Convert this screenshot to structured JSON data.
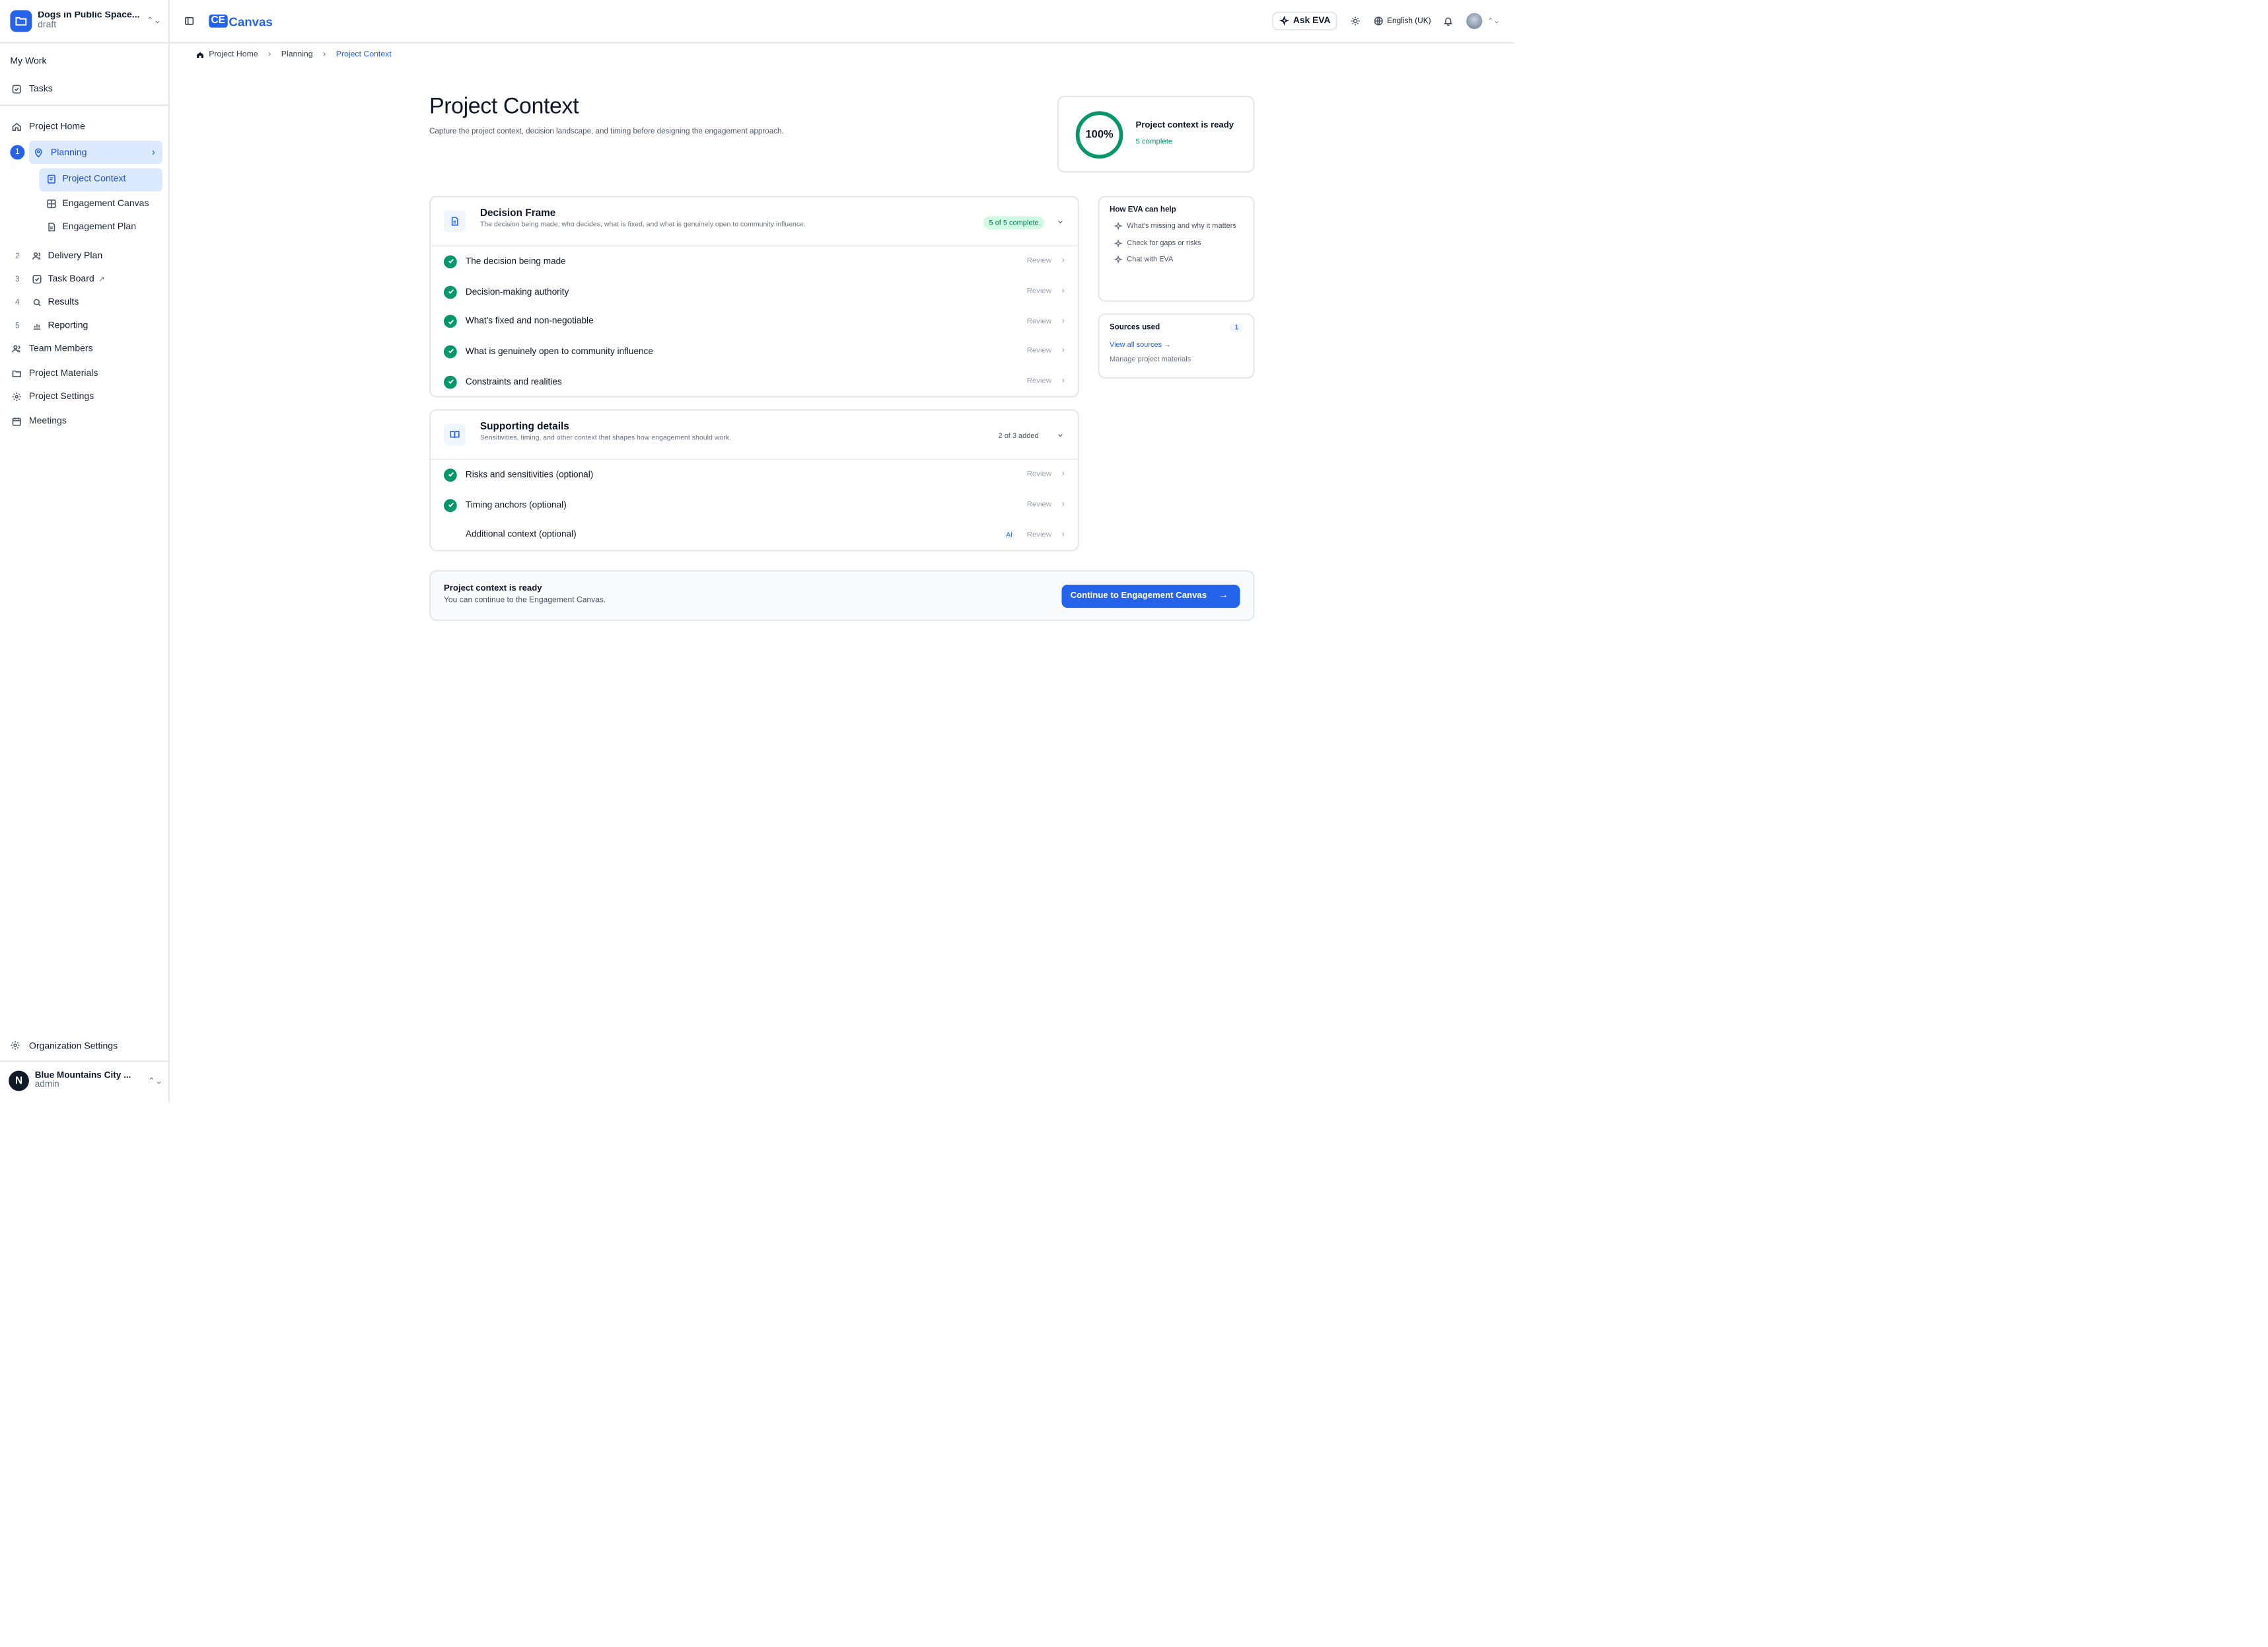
{
  "project": {
    "name": "Dogs in Public Space...",
    "status": "draft"
  },
  "nav": {
    "my_work": "My Work",
    "tasks": "Tasks",
    "project_home": "Project Home",
    "planning": {
      "num": "1",
      "label": "Planning"
    },
    "planning_sub": [
      "Project Context",
      "Engagement Canvas",
      "Engagement Plan"
    ],
    "steps": [
      {
        "num": "2",
        "label": "Delivery Plan"
      },
      {
        "num": "3",
        "label": "Task Board"
      },
      {
        "num": "4",
        "label": "Results"
      },
      {
        "num": "5",
        "label": "Reporting"
      }
    ],
    "team_members": "Team Members",
    "project_materials": "Project Materials",
    "project_settings": "Project Settings",
    "meetings": "Meetings",
    "org_settings": "Organization Settings"
  },
  "user": {
    "initial": "N",
    "org": "Blue Mountains City ...",
    "role": "admin"
  },
  "header": {
    "logo_badge": "CE",
    "logo_text": "Canvas",
    "ask_eva": "Ask EVA",
    "language": "English (UK)"
  },
  "breadcrumb": [
    "Project Home",
    "Planning",
    "Project Context"
  ],
  "page": {
    "title": "Project Context",
    "description": "Capture the project context, decision landscape, and timing before designing the engagement approach."
  },
  "ready": {
    "percent": "100%",
    "progress": 1.0,
    "title": "Project context is ready",
    "sub": "5 complete",
    "ring_color": "#059669"
  },
  "decision_frame": {
    "title": "Decision Frame",
    "subtitle": "The decision being made, who decides, what is fixed, and what is genuinely open to community influence.",
    "badge": "5 of 5 complete",
    "items": [
      {
        "label": "The decision being made",
        "action": "Review"
      },
      {
        "label": "Decision-making authority",
        "action": "Review"
      },
      {
        "label": "What's fixed and non-negotiable",
        "action": "Review"
      },
      {
        "label": "What is genuinely open to community influence",
        "action": "Review"
      },
      {
        "label": "Constraints and realities",
        "action": "Review"
      }
    ]
  },
  "supporting": {
    "title": "Supporting details",
    "subtitle": "Sensitivities, timing, and other context that shapes how engagement should work.",
    "badge": "2 of 3 added",
    "items": [
      {
        "label": "Risks and sensitivities (optional)",
        "action": "Review"
      },
      {
        "label": "Timing anchors (optional)",
        "action": "Review"
      },
      {
        "label": "Additional context (optional)",
        "action": "Review",
        "tag": "AI"
      }
    ]
  },
  "eva_help": {
    "title": "How EVA can help",
    "items": [
      "What's missing and why it matters",
      "Check for gaps or risks",
      "Chat with EVA"
    ]
  },
  "sources": {
    "title": "Sources used",
    "count": "1",
    "view_all": "View all sources",
    "manage": "Manage project materials"
  },
  "footer": {
    "title": "Project context is ready",
    "sub": "You can continue to the Engagement Canvas.",
    "button": "Continue to Engagement Canvas"
  },
  "colors": {
    "accent": "#2563eb",
    "success": "#059669",
    "highlight": "#dbeafe"
  }
}
